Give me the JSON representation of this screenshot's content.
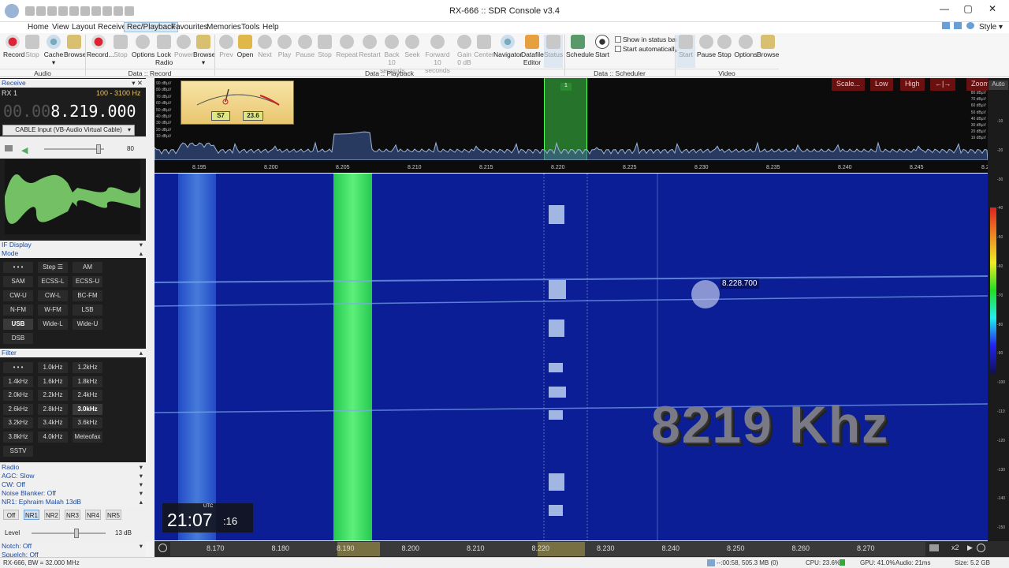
{
  "window": {
    "title": "RX-666 :: SDR Console v3.4",
    "minimize": "—",
    "restore": "▢",
    "close": "✕"
  },
  "menu": {
    "items": [
      "Home",
      "View",
      "Layout",
      "Receive",
      "Rec/Playback",
      "Favourites",
      "Memories",
      "Tools",
      "Help"
    ],
    "active": "Rec/Playback",
    "style_label": "Style"
  },
  "ribbon": {
    "buttons": {
      "record": "Record",
      "stop1": "Stop",
      "cache": "Cache",
      "browse1": "Browse",
      "record2": "Record...",
      "stop2": "Stop",
      "options": "Options",
      "lock_radio": "Lock Radio",
      "power": "Power",
      "browse2": "Browse",
      "prev": "Prev",
      "open": "Open",
      "next": "Next",
      "play": "Play",
      "pause": "Pause",
      "stop3": "Stop",
      "repeat": "Repeat",
      "restart": "Restart",
      "back10": "Back 10 seconds",
      "seek": "Seek",
      "fwd10": "Forward 10 seconds",
      "gain0": "Gain 0 dB",
      "center": "Center",
      "navigator": "Navigator",
      "datafile_editor": "Datafile Editor",
      "status": "Status",
      "schedule": "Schedule",
      "start": "Start",
      "show_status": "Show in status bar",
      "start_auto": "Start automatically",
      "vstart": "Start",
      "vpause": "Pause",
      "vstop": "Stop",
      "voptions": "Options",
      "vbrowse": "Browse"
    },
    "groups": {
      "audio": "Audio",
      "data_record": "Data :: Record",
      "data_playback": "Data :: Playback",
      "data_scheduler": "Data :: Scheduler",
      "video": "Video"
    }
  },
  "left": {
    "receive_header": "Receive",
    "rx_label": "RX 1",
    "bw_range": "100 - 3100 Hz",
    "freq_dim": "00.00",
    "freq_main": "8.219.000",
    "input_device": "CABLE Input (VB-Audio Virtual Cable)",
    "volume": "80",
    "if_display": "IF Display",
    "mode_header": "Mode",
    "mode_buttons": [
      "• • •",
      "Step ☰",
      "AM",
      "SAM",
      "ECSS-L",
      "ECSS-U",
      "CW-U",
      "CW-L",
      "BC-FM",
      "N-FM",
      "W-FM",
      "LSB",
      "USB",
      "Wide-L",
      "Wide-U",
      "DSB"
    ],
    "mode_selected": "USB",
    "filter_header": "Filter",
    "filter_buttons": [
      "• • •",
      "1.0kHz",
      "1.2kHz",
      "1.4kHz",
      "1.6kHz",
      "1.8kHz",
      "2.0kHz",
      "2.2kHz",
      "2.4kHz",
      "2.6kHz",
      "2.8kHz",
      "3.0kHz",
      "3.2kHz",
      "3.4kHz",
      "3.6kHz",
      "3.8kHz",
      "4.0kHz",
      "Meteofax",
      "SSTV"
    ],
    "filter_selected": "3.0kHz",
    "radio_header": "Radio",
    "agc": "AGC: Slow",
    "cw": "CW: Off",
    "noise_blanker": "Noise Blanker: Off",
    "nr1": "NR1: Ephraim Malah 13dB",
    "nr_buttons": [
      "Off",
      "NR1",
      "NR2",
      "NR3",
      "NR4",
      "NR5"
    ],
    "nr_selected": "NR1",
    "level_label": "Level",
    "level_value": "13 dB",
    "notch": "Notch: Off",
    "squelch": "Squelch: Off"
  },
  "spectrum": {
    "dbuv": [
      "90 dBµV",
      "80 dBµV",
      "70 dBµV",
      "60 dBµV",
      "50 dBµV",
      "40 dBµV",
      "30 dBµV",
      "20 dBµV",
      "10 dBµV"
    ],
    "dbuv_right": [
      "80 dBµV",
      "70 dBµV",
      "60 dBµV",
      "50 dBµV",
      "40 dBµV",
      "30 dBµV",
      "20 dBµV",
      "10 dBµV"
    ],
    "ticks": [
      "8.195",
      "8.200",
      "8.205",
      "8.210",
      "8.215",
      "8.220",
      "8.225",
      "8.230",
      "8.235",
      "8.240",
      "8.245",
      "8.2"
    ],
    "meter_s": "S7",
    "meter_val": "23.6",
    "marker_no": "1",
    "scale_btns": [
      "Scale...",
      "Low",
      "High",
      "←|→",
      "Zoom"
    ],
    "auto": "Auto",
    "right_scale": [
      "-10",
      "-20",
      "-30",
      "-40",
      "-50",
      "-60",
      "-70",
      "-80",
      "-90",
      "-100",
      "-110",
      "-120",
      "-130",
      "-140",
      "-150"
    ]
  },
  "waterfall": {
    "cursor_freq": "8.228.700",
    "overlay_text": "8219 Khz",
    "clock_utc": "UTC",
    "clock_hm": "21:07",
    "clock_s": ":16"
  },
  "freqaxis": {
    "ticks": [
      "8.170",
      "8.180",
      "8.190",
      "8.200",
      "8.210",
      "8.220",
      "8.230",
      "8.240",
      "8.250",
      "8.260",
      "8.270"
    ],
    "zoom": "x2"
  },
  "status": {
    "left": "RX-666, BW = 32.000 MHz",
    "rec": "--:00:58, 505.3 MB (0)",
    "cpu": "CPU: 23.6%",
    "gpu": "GPU: 41.0%",
    "audio": "Audio: 21ms",
    "size": "Size: 5.2 GB"
  },
  "colors": {
    "waterfall_bg": "#0a1a8c",
    "signal_green": "#35e85a",
    "accent_blue": "#1a4aa0"
  }
}
